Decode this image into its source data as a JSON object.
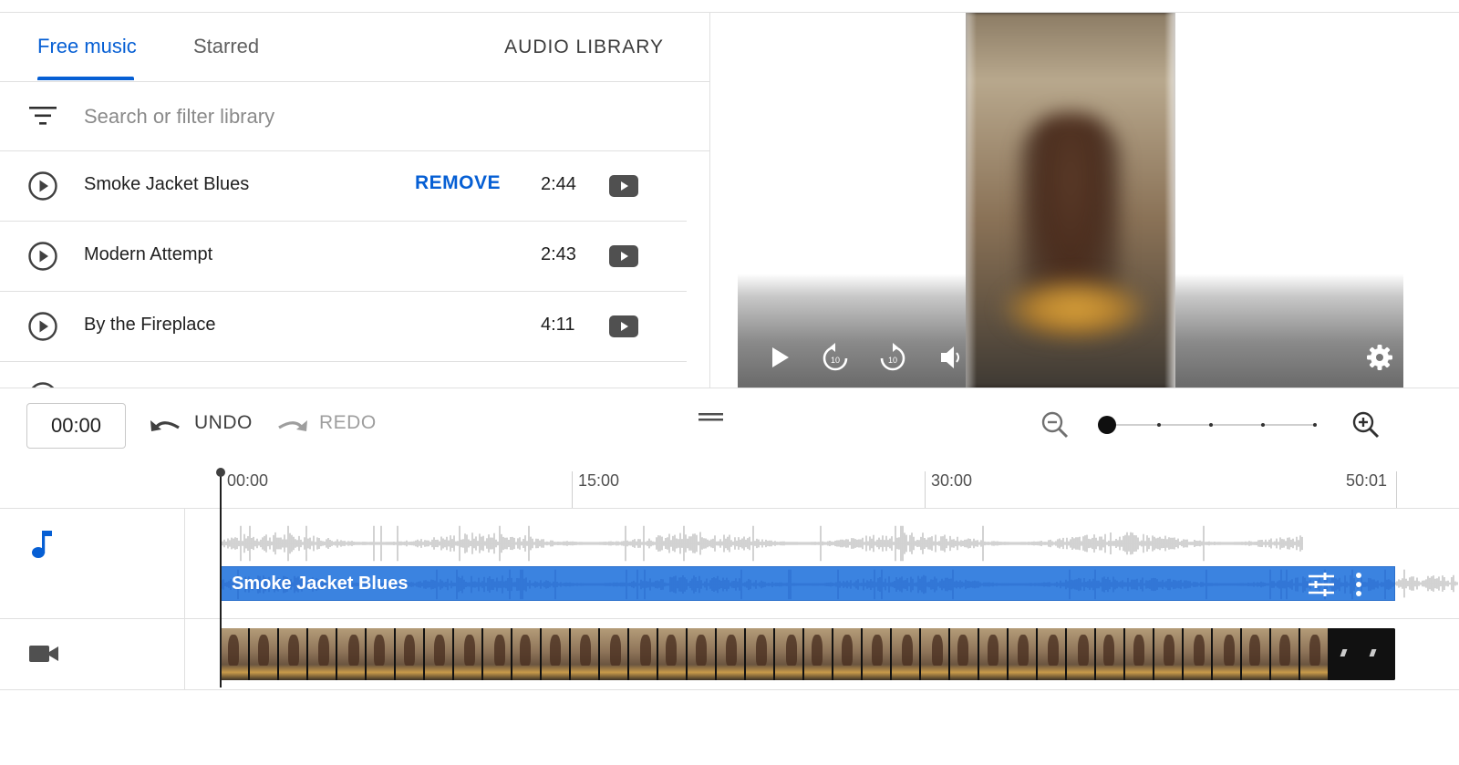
{
  "library": {
    "tabs": [
      {
        "label": "Free music",
        "active": true
      },
      {
        "label": "Starred",
        "active": false
      }
    ],
    "title": "AUDIO LIBRARY",
    "search_placeholder": "Search or filter library",
    "tracks": [
      {
        "title": "Smoke Jacket Blues",
        "action": "REMOVE",
        "duration": "2:44"
      },
      {
        "title": "Modern Attempt",
        "duration": "2:43"
      },
      {
        "title": "By the Fireplace",
        "duration": "4:11"
      }
    ]
  },
  "player": {
    "controls": [
      "play-icon",
      "replay-10-icon",
      "forward-10-icon",
      "volume-icon",
      "settings-icon"
    ]
  },
  "toolbar": {
    "time": "00:00",
    "undo_label": "UNDO",
    "redo_label": "REDO",
    "zoom_level": 0
  },
  "timeline": {
    "ticks": [
      "00:00",
      "15:00",
      "30:00",
      "50:01"
    ],
    "audio_clip": {
      "title": "Smoke Jacket Blues"
    },
    "colors": {
      "accent": "#065fd4",
      "clip": "#3b83e0"
    }
  }
}
